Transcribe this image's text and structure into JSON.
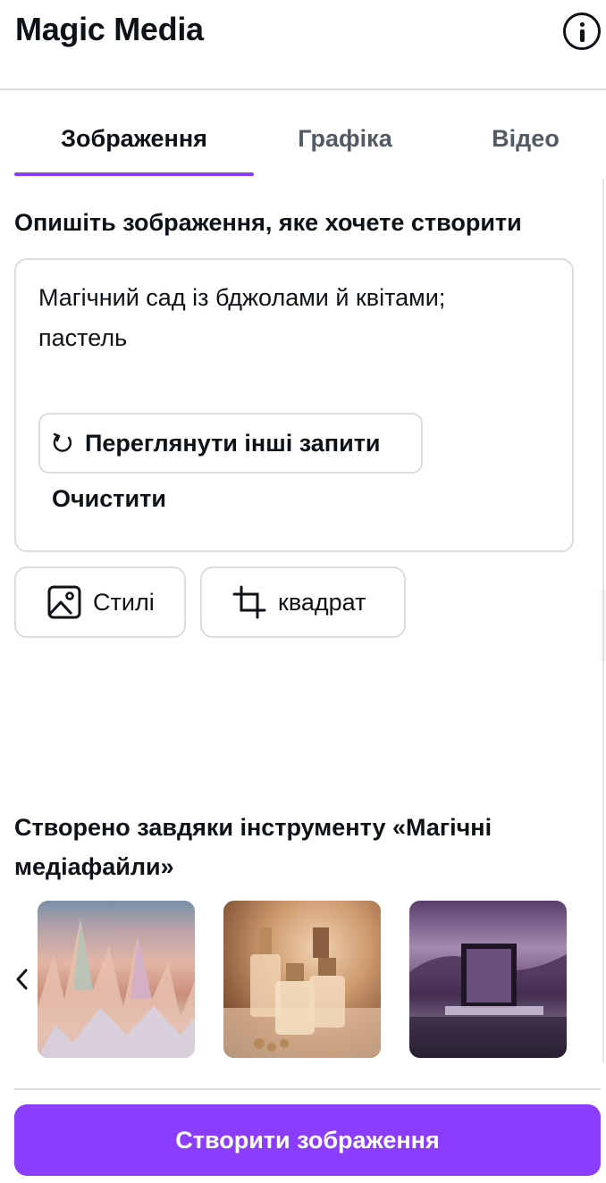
{
  "header": {
    "title": "Magic Media",
    "info_icon": "info-icon"
  },
  "tabs": [
    {
      "label": "Зображення",
      "active": true
    },
    {
      "label": "Графіка",
      "active": false
    },
    {
      "label": "Відео",
      "active": false
    }
  ],
  "prompt": {
    "heading": "Опишіть зображення, яке хочете створити",
    "value": "Магічний сад із бджолами й квітами; пастель",
    "more_prompts_label": "Переглянути інші запити",
    "more_prompts_icon": "refresh-icon",
    "clear_label": "Очистити"
  },
  "options": {
    "styles_label": "Стилі",
    "styles_icon": "image-icon",
    "aspect_label": "квадрат",
    "aspect_icon": "crop-icon"
  },
  "gallery": {
    "heading": "Створено завдяки інструменту «Магічні медіафайли»",
    "prev_icon": "chevron-left-icon",
    "thumbnails": [
      "rainbow-rock-formations",
      "perfume-bottles",
      "purple-landscape-frame"
    ]
  },
  "footer": {
    "create_label": "Створити зображення"
  },
  "colors": {
    "accent": "#8b3dff",
    "border": "#d9dde1",
    "text": "#0d1216"
  }
}
